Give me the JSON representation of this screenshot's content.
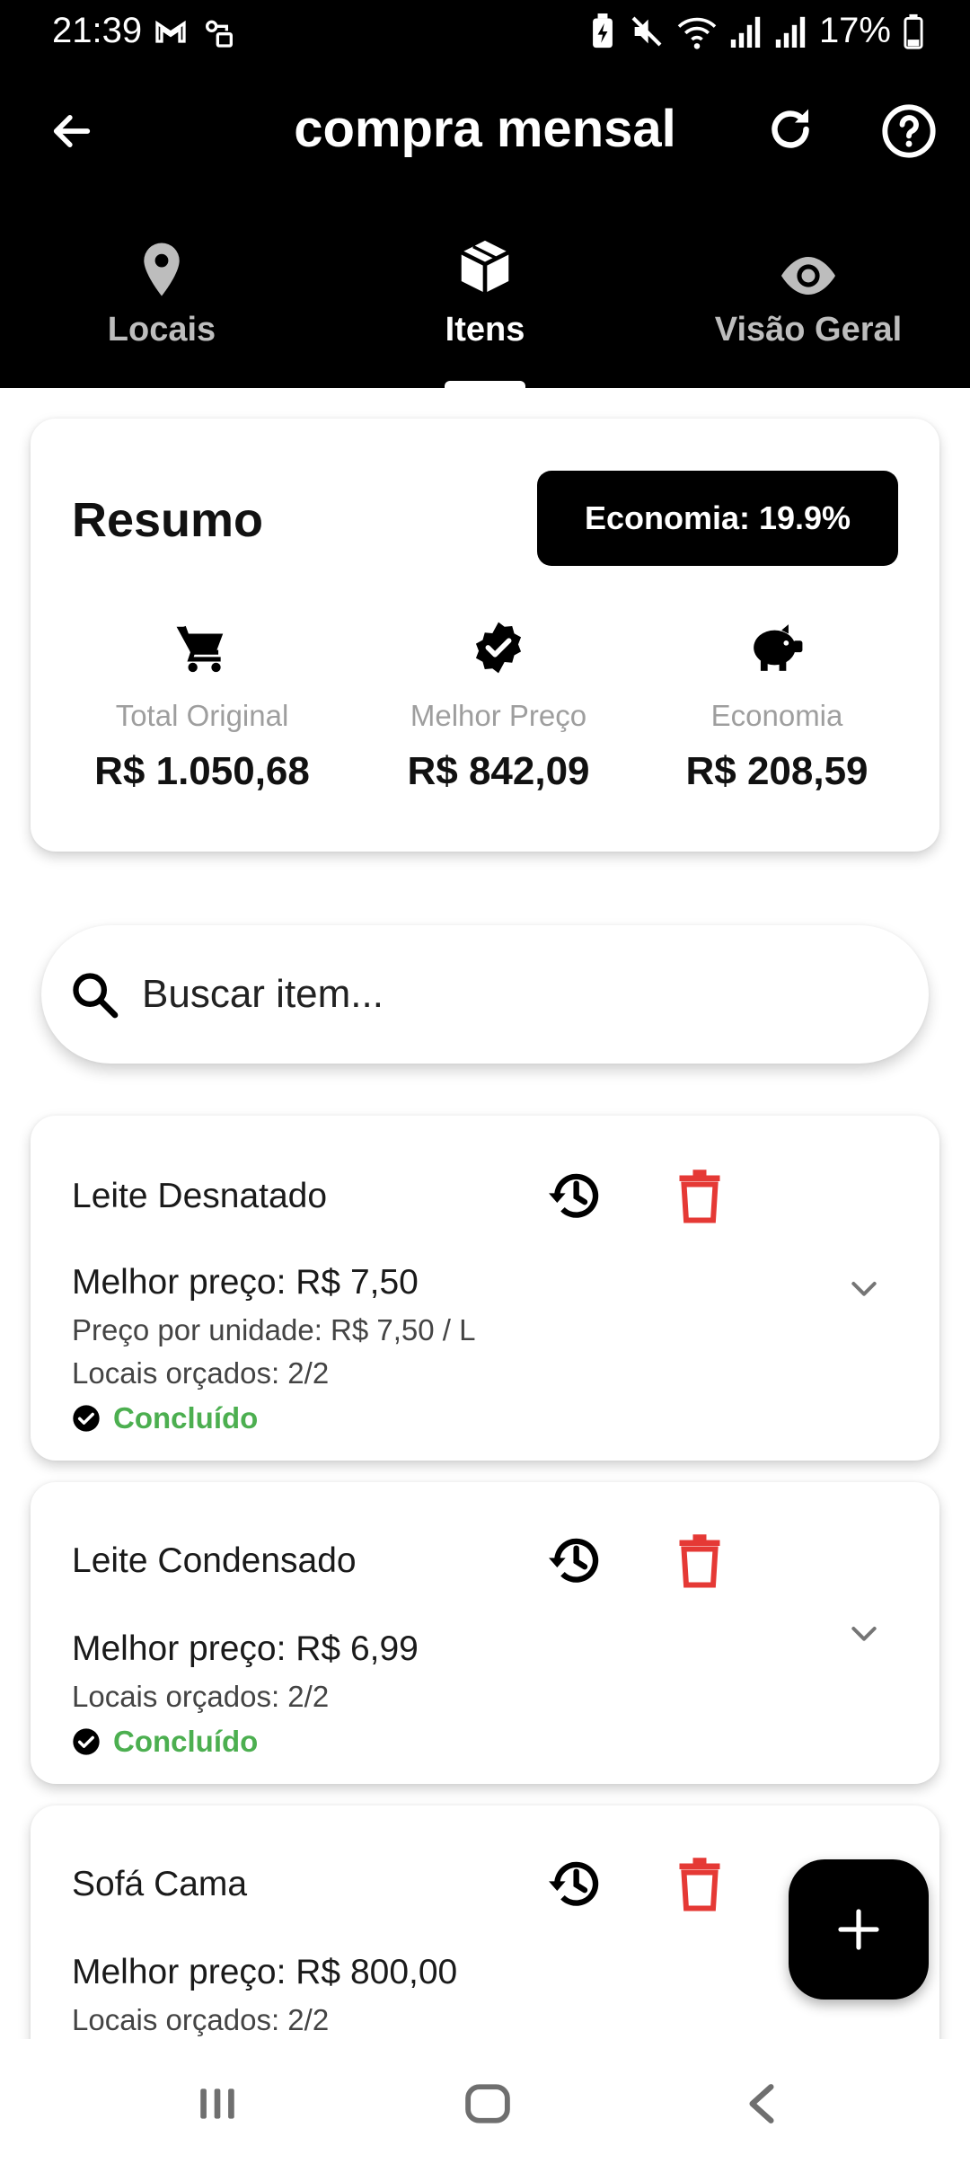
{
  "status_bar": {
    "time": "21:39",
    "battery": "17%",
    "icons": [
      "gmail-icon",
      "vpn-key-icon",
      "battery-saver-icon",
      "mute-icon",
      "wifi-icon",
      "signal-icon",
      "signal-icon",
      "battery-icon"
    ]
  },
  "header": {
    "title": "compra mensal",
    "back_icon": "arrow-back-icon",
    "refresh_icon": "refresh-icon",
    "help_icon": "help-circle-icon"
  },
  "tabs": [
    {
      "label": "Locais",
      "icon": "location-pin-icon",
      "active": false
    },
    {
      "label": "Itens",
      "icon": "box-icon",
      "active": true
    },
    {
      "label": "Visão Geral",
      "icon": "eye-icon",
      "active": false
    }
  ],
  "summary": {
    "title": "Resumo",
    "badge": "Economia: 19.9%",
    "stats": [
      {
        "icon": "cart-icon",
        "label": "Total Original",
        "value": "R$ 1.050,68"
      },
      {
        "icon": "verified-badge-icon",
        "label": "Melhor Preço",
        "value": "R$ 842,09"
      },
      {
        "icon": "piggy-bank-icon",
        "label": "Economia",
        "value": "R$ 208,59"
      }
    ]
  },
  "search": {
    "placeholder": "Buscar item..."
  },
  "items": [
    {
      "name": "Leite Desnatado",
      "best_price": "Melhor preço: R$ 7,50",
      "unit_price": "Preço por unidade: R$ 7,50 / L",
      "locations": "Locais orçados: 2/2",
      "status": "Concluído"
    },
    {
      "name": "Leite Condensado",
      "best_price": "Melhor preço: R$ 6,99",
      "locations": "Locais orçados: 2/2",
      "status": "Concluído"
    },
    {
      "name": "Sofá Cama",
      "best_price": "Melhor preço: R$ 800,00",
      "locations": "Locais orçados: 2/2"
    }
  ],
  "fab": {
    "icon": "plus-icon"
  },
  "nav": {
    "icons": [
      "recent-apps-icon",
      "home-icon",
      "back-icon"
    ]
  },
  "colors": {
    "primary": "#000000",
    "delete": "#e53935",
    "success": "#4caf50",
    "muted": "#9e9e9e"
  }
}
